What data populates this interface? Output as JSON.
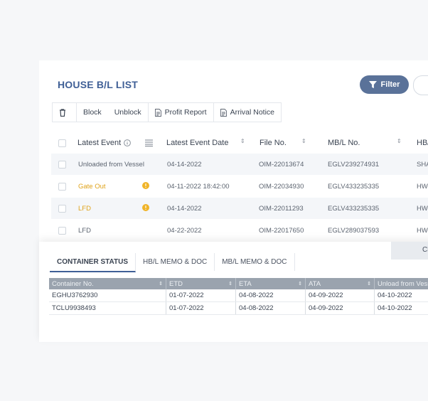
{
  "page": {
    "title": "HOUSE B/L LIST"
  },
  "toolbar": {
    "filter_label": "Filter",
    "block_label": "Block",
    "unblock_label": "Unblock",
    "profit_report_label": "Profit Report",
    "arrival_notice_label": "Arrival Notice"
  },
  "table": {
    "headers": [
      "Latest Event",
      "Latest Event Date",
      "File No.",
      "MB/L No.",
      "HB/"
    ],
    "rows": [
      {
        "event": "Unloaded from Vessel",
        "date": "04-14-2022",
        "file": "OIM-22013674",
        "mbl": "EGLV239274931",
        "hbl": "SHA",
        "warn": false,
        "highlight": false
      },
      {
        "event": "Gate Out",
        "date": "04-11-2022 18:42:00",
        "file": "OIM-22034930",
        "mbl": "EGLV433235335",
        "hbl": "HW.",
        "warn": true,
        "highlight": true
      },
      {
        "event": "LFD",
        "date": "04-14-2022",
        "file": "OIM-22011293",
        "mbl": "EGLV433235335",
        "hbl": "HW.",
        "warn": true,
        "highlight": true
      },
      {
        "event": "LFD",
        "date": "04-22-2022",
        "file": "OIM-22017650",
        "mbl": "EGLV289037593",
        "hbl": "HW.",
        "warn": false,
        "highlight": false
      }
    ]
  },
  "panel": {
    "tabs": [
      "CONTAINER STATUS",
      "HB/L MEMO & DOC",
      "MB/L MEMO & DOC"
    ],
    "right_tab": "Cl",
    "container_table": {
      "headers": [
        "Container No.",
        "ETD",
        "ETA",
        "ATA",
        "Unload from Vess"
      ],
      "rows": [
        [
          "EGHU3762930",
          "01-07-2022",
          "04-08-2022",
          "04-09-2022",
          "04-10-2022"
        ],
        [
          "TCLU9938493",
          "01-07-2022",
          "04-08-2022",
          "04-09-2022",
          "04-10-2022"
        ]
      ]
    }
  },
  "colors": {
    "accent": "#3f5f96",
    "filter_bg": "#5a7299",
    "highlight_text": "#e0a31a",
    "header_gray": "#9aa3ae"
  },
  "icons": [
    "trash-icon",
    "document-icon",
    "filter-icon",
    "info-icon",
    "menu-icon",
    "sort-icon",
    "warning-icon"
  ]
}
